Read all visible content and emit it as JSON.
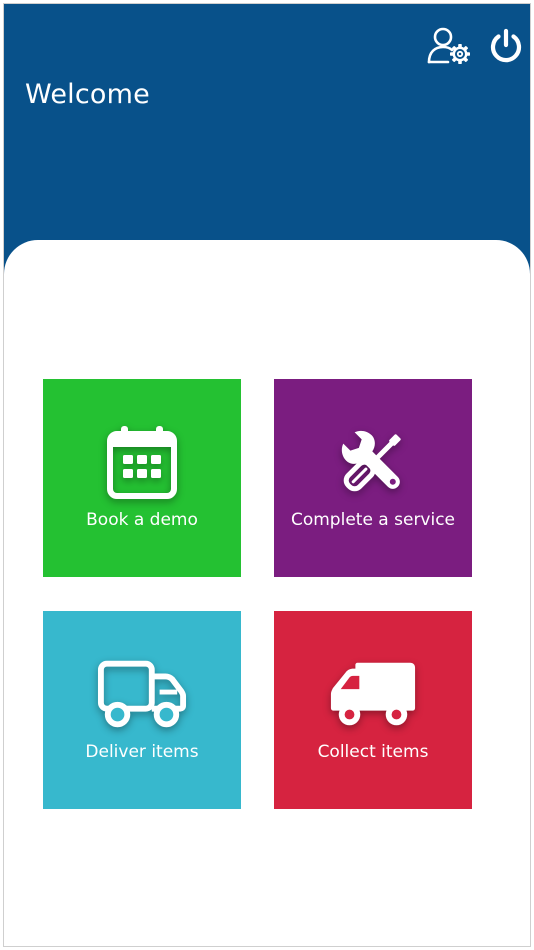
{
  "header": {
    "title": "Welcome",
    "user_settings_icon": "user-settings-icon",
    "logout_icon": "power-icon",
    "background_color": "#08518a"
  },
  "tiles": [
    {
      "label": "Book a demo",
      "icon": "calendar-icon",
      "color": "#24c132"
    },
    {
      "label": "Complete a service",
      "icon": "tools-icon",
      "color": "#7b1d80"
    },
    {
      "label": "Deliver items",
      "icon": "truck-outline-icon",
      "color": "#37b8cd"
    },
    {
      "label": "Collect items",
      "icon": "van-icon",
      "color": "#d62340"
    }
  ]
}
